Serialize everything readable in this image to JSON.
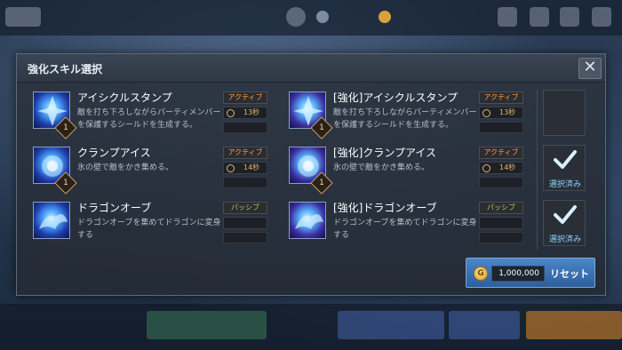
{
  "dialog": {
    "title": "強化スキル選択",
    "close_icon": "close-icon"
  },
  "skills_left": [
    {
      "name": "アイシクルスタンプ",
      "desc": "敵を打ち下ろしながらパーティメンバーを保護するシールドを生成する。",
      "type": "アクティブ",
      "cooldown": "13秒",
      "level": "1"
    },
    {
      "name": "クランプアイス",
      "desc": "氷の壁で敵をかき集める。",
      "type": "アクティブ",
      "cooldown": "14秒",
      "level": "1"
    },
    {
      "name": "ドラゴンオーブ",
      "desc": "ドラゴンオーブを集めてドラゴンに変身する",
      "type": "パッシブ",
      "cooldown": "",
      "level": ""
    }
  ],
  "skills_right": [
    {
      "name": "[強化]アイシクルスタンプ",
      "desc": "敵を打ち下ろしながらパーティメンバーを保護するシールドを生成する。",
      "type": "アクティブ",
      "cooldown": "13秒",
      "level": "1"
    },
    {
      "name": "[強化]クランプアイス",
      "desc": "氷の壁で敵をかき集める。",
      "type": "アクティブ",
      "cooldown": "14秒",
      "level": "1"
    },
    {
      "name": "[強化]ドラゴンオーブ",
      "desc": "ドラゴンオーブを集めてドラゴンに変身する",
      "type": "パッシブ",
      "cooldown": "",
      "level": ""
    }
  ],
  "slots": [
    {
      "selected": false,
      "label": ""
    },
    {
      "selected": true,
      "label": "選択済み"
    },
    {
      "selected": true,
      "label": "選択済み"
    }
  ],
  "reset": {
    "cost": "1,000,000",
    "label": "リセット"
  },
  "colors": {
    "active_type": "#ff9a3c",
    "passive_type": "#a6d25a",
    "selected_label": "#8dd3ff",
    "reset_button": "#3c74b6"
  }
}
